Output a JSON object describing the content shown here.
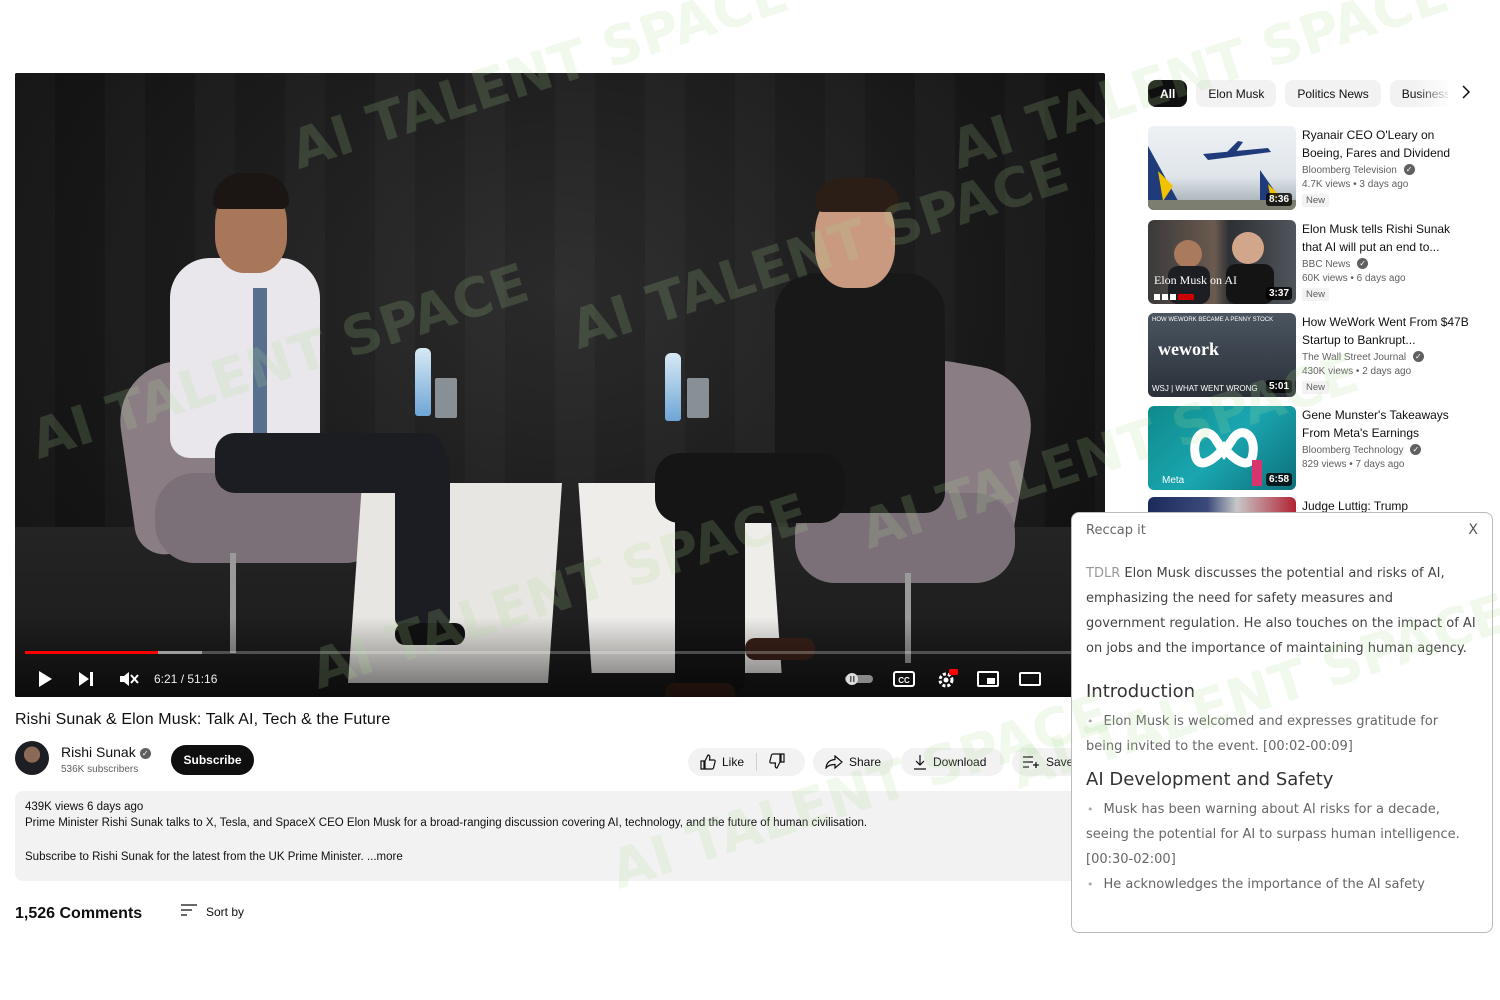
{
  "player": {
    "time": "6:21 / 51:16",
    "progress_fraction": 0.124,
    "buffer_fraction": 0.165
  },
  "video": {
    "title": "Rishi Sunak & Elon Musk: Talk AI, Tech & the Future",
    "channel_name": "Rishi Sunak",
    "subscribers": "536K subscribers",
    "subscribe_label": "Subscribe",
    "like_label": "Like",
    "share_label": "Share",
    "download_label": "Download",
    "save_label": "Save"
  },
  "description": {
    "meta": "439K views  6 days ago",
    "line1": "Prime Minister Rishi Sunak talks to X, Tesla, and SpaceX CEO Elon Musk for a broad-ranging discussion covering AI, technology, and the future of human civilisation.",
    "line2": "Subscribe to Rishi Sunak for the latest from the UK Prime Minister.",
    "more": "...more"
  },
  "comments": {
    "count": "1,526 Comments",
    "sort_label": "Sort by"
  },
  "chips": [
    "All",
    "Elon Musk",
    "Politics News",
    "Business"
  ],
  "recommendations": [
    {
      "title": "Ryanair CEO O'Leary on Boeing, Fares and Dividend",
      "channel": "Bloomberg Television",
      "views": "4.7K views",
      "age": "3 days ago",
      "duration": "8:36",
      "badge": "New"
    },
    {
      "title": "Elon Musk tells Rishi Sunak that AI will put an end to...",
      "channel": "BBC News",
      "views": "60K views",
      "age": "6 days ago",
      "duration": "3:37",
      "badge": "New",
      "thumb_caption": "Elon Musk on AI"
    },
    {
      "title": "How WeWork Went From $47B Startup to Bankrupt...",
      "channel": "The Wall Street Journal",
      "views": "430K views",
      "age": "2 days ago",
      "duration": "5:01",
      "badge": "New",
      "thumb_topline": "HOW WEWORK BECAME A PENNY STOCK",
      "thumb_brand": "wework",
      "thumb_subbrand": "WSJ | WHAT WENT WRONG"
    },
    {
      "title": "Gene Munster's Takeaways From Meta's Earnings",
      "channel": "Bloomberg Technology",
      "views": "829 views",
      "age": "7 days ago",
      "duration": "6:58",
      "thumb_subbrand": "Meta"
    },
    {
      "title": "Judge Luttig: Trump"
    }
  ],
  "recap": {
    "title": "Reccap it",
    "close": "X",
    "tldr_label": "TDLR",
    "tldr_text": "Elon Musk discusses the potential and risks of AI, emphasizing the need for safety measures and government regulation. He also touches on the impact of AI on jobs and the importance of maintaining human agency.",
    "sections": [
      {
        "heading": "Introduction",
        "bullets": [
          "Elon Musk is welcomed and expresses gratitude for being invited to the event. [00:02-00:09]"
        ]
      },
      {
        "heading": "AI Development and Safety",
        "bullets": [
          "Musk has been warning about AI risks for a decade, seeing the potential for AI to surpass human intelligence. [00:30-02:00]",
          "He acknowledges the importance of the AI safety"
        ]
      }
    ]
  },
  "watermark": "AI TALENT SPACE",
  "colors": {
    "progress_played": "#ff0000",
    "subscribe_bg": "#0f0f0f",
    "chip_active_bg": "#0f0f0f",
    "chip_bg": "#f2f2f2"
  },
  "icons": [
    "play-icon",
    "next-icon",
    "mute-icon",
    "autoplay-toggle-icon",
    "captions-icon",
    "settings-icon",
    "miniplayer-icon",
    "theater-icon",
    "thumbs-up-icon",
    "thumbs-down-icon",
    "share-icon",
    "download-icon",
    "save-icon",
    "verified-icon",
    "sort-icon",
    "chevron-right-icon"
  ]
}
